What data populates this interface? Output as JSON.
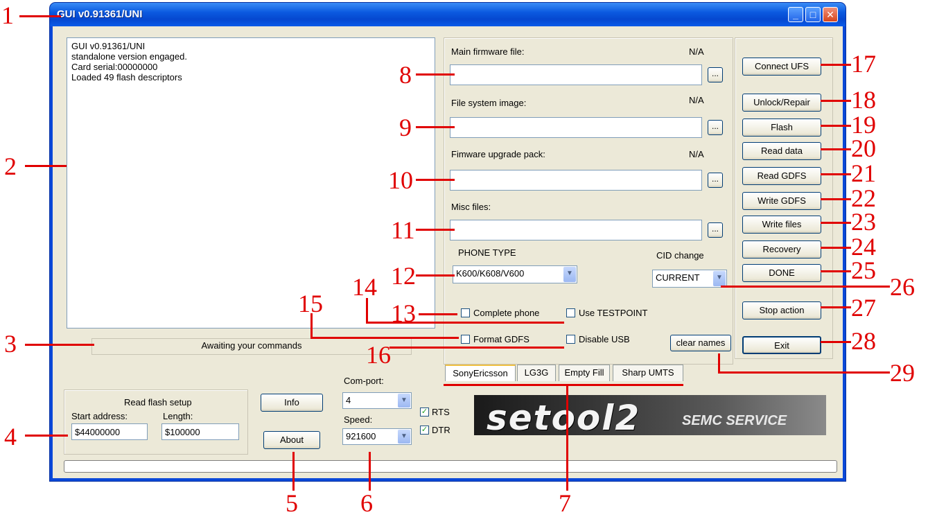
{
  "window": {
    "title": "GUI v0.91361/UNI"
  },
  "log": {
    "lines": [
      "GUI v0.91361/UNI",
      "standalone version engaged.",
      "Card serial:00000000",
      "Loaded 49 flash descriptors"
    ]
  },
  "status_text": "Awaiting your commands",
  "read_flash": {
    "title": "Read flash setup",
    "start_label": "Start address:",
    "length_label": "Length:",
    "start_value": "$44000000",
    "length_value": "$100000"
  },
  "buttons_left": {
    "info": "Info",
    "about": "About"
  },
  "comport": {
    "label": "Com-port:",
    "value": "4",
    "speed_label": "Speed:",
    "speed_value": "921600",
    "rts_label": "RTS",
    "dtr_label": "DTR",
    "rts_checked": true,
    "dtr_checked": true
  },
  "files": {
    "main_label": "Main firmware file:",
    "main_status": "N/A",
    "fs_label": "File system image:",
    "fs_status": "N/A",
    "pack_label": "Fimware upgrade pack:",
    "pack_status": "N/A",
    "misc_label": "Misc files:",
    "browse": "..."
  },
  "phone": {
    "type_label": "PHONE TYPE",
    "type_value": "K600/K608/V600",
    "cid_label": "CID change",
    "cid_value": "CURRENT"
  },
  "options": {
    "complete_phone": "Complete phone",
    "use_testpoint": "Use TESTPOINT",
    "format_gdfs": "Format GDFS",
    "disable_usb": "Disable USB",
    "clear_names": "clear names"
  },
  "tabs": [
    "SonyEricsson",
    "LG3G",
    "Empty Fill",
    "Sharp UMTS"
  ],
  "right_buttons": {
    "connect": "Connect UFS",
    "unlock": "Unlock/Repair",
    "flash": "Flash",
    "read_data": "Read data",
    "read_gdfs": "Read GDFS",
    "write_gdfs": "Write GDFS",
    "write_files": "Write files",
    "recovery": "Recovery",
    "done": "DONE",
    "stop": "Stop action",
    "exit": "Exit"
  },
  "logo": {
    "main": "setool2",
    "sub": "SEMC SERVICE"
  },
  "annotations": [
    "1",
    "2",
    "3",
    "4",
    "5",
    "6",
    "7",
    "8",
    "9",
    "10",
    "11",
    "12",
    "13",
    "14",
    "15",
    "16",
    "17",
    "18",
    "19",
    "20",
    "21",
    "22",
    "23",
    "24",
    "25",
    "26",
    "27",
    "28",
    "29"
  ],
  "colors": {
    "annotation": "#e00000",
    "titlebar": "#0b5ae0",
    "client": "#ece9d8"
  }
}
